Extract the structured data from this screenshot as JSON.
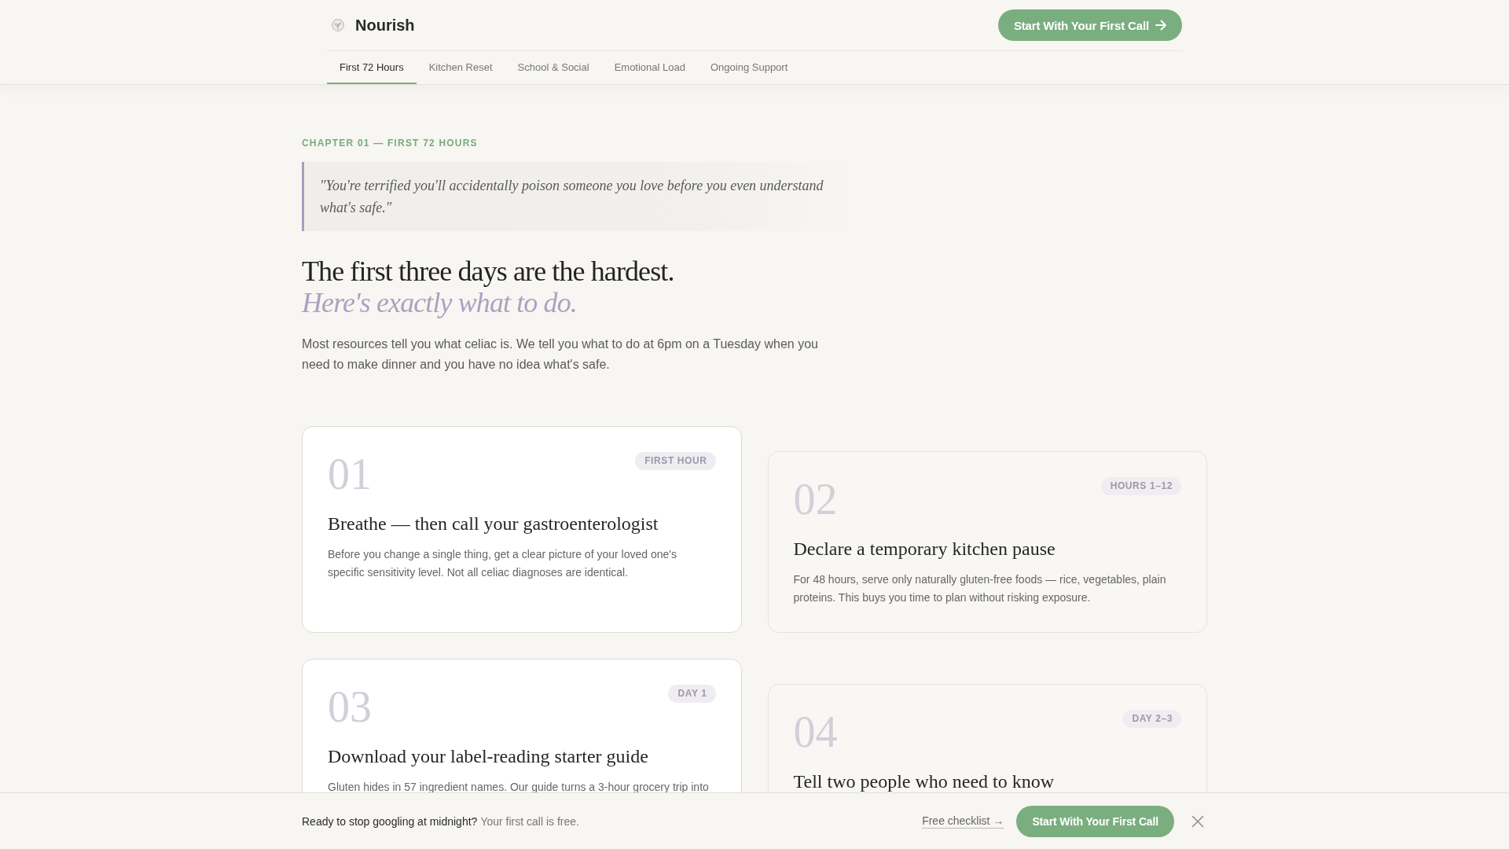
{
  "header": {
    "brand": "Nourish",
    "cta": "Start With Your First Call"
  },
  "tabs": [
    {
      "label": "First 72 Hours",
      "selected": true
    },
    {
      "label": "Kitchen Reset",
      "selected": false
    },
    {
      "label": "School & Social",
      "selected": false
    },
    {
      "label": "Emotional Load",
      "selected": false
    },
    {
      "label": "Ongoing Support",
      "selected": false
    }
  ],
  "intro": {
    "eyebrow": "CHAPTER 01 — FIRST 72 HOURS",
    "quote": "\"You're terrified you'll accidentally poison someone you love before you even understand what's safe.\"",
    "title": "The first three days are the hardest.",
    "subtitle": "Here's exactly what to do.",
    "body": "Most resources tell you what celiac is. We tell you what to do at 6pm on a Tuesday when you need to make dinner and you have no idea what's safe."
  },
  "steps": [
    {
      "number": "01",
      "badge": "FIRST HOUR",
      "title": "Breathe — then call your gastroenterologist",
      "text": "Before you change a single thing, get a clear picture of your loved one's specific sensitivity level. Not all celiac diagnoses are identical."
    },
    {
      "number": "02",
      "badge": "HOURS 1–12",
      "title": "Declare a temporary kitchen pause",
      "text": "For 48 hours, serve only naturally gluten-free foods — rice, vegetables, plain proteins. This buys you time to plan without risking exposure."
    },
    {
      "number": "03",
      "badge": "DAY 1",
      "title": "Download your label-reading starter guide",
      "text": "Gluten hides in 57 ingredient names. Our guide turns a 3-hour grocery trip into"
    },
    {
      "number": "04",
      "badge": "DAY 2–3",
      "title": "Tell two people who need to know"
    }
  ],
  "bottom_bar": {
    "question": "Ready to stop googling at midnight?",
    "note": "Your first call is free.",
    "link": "Free checklist →",
    "cta": "Start With Your First Call"
  }
}
